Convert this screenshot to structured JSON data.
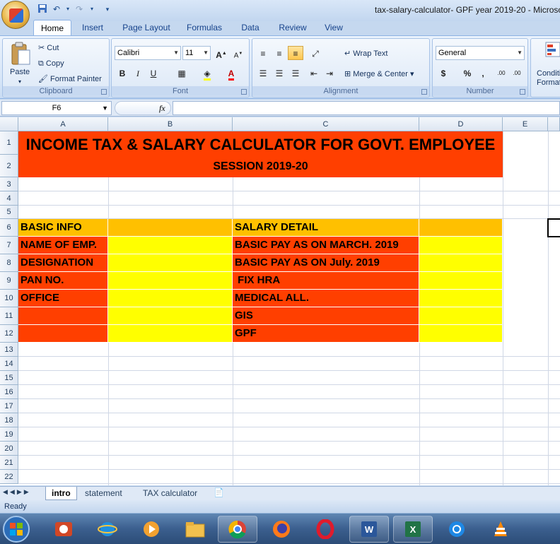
{
  "window": {
    "title": "tax-salary-calculator- GPF year 2019-20 - Microso"
  },
  "quick_access": {
    "save_icon": "save-icon",
    "undo_icon": "undo-icon",
    "redo_icon": "redo-icon"
  },
  "ribbon": {
    "tabs": [
      "Home",
      "Insert",
      "Page Layout",
      "Formulas",
      "Data",
      "Review",
      "View"
    ],
    "active_tab": "Home",
    "clipboard": {
      "paste": "Paste",
      "cut": "Cut",
      "copy": "Copy",
      "format_painter": "Format Painter",
      "label": "Clipboard"
    },
    "font": {
      "name": "Calibri",
      "size": "11",
      "bold": "B",
      "italic": "I",
      "underline": "U",
      "grow": "A",
      "shrink": "A",
      "font_color": "A",
      "label": "Font"
    },
    "alignment": {
      "wrap_text": "Wrap Text",
      "merge_center": "Merge & Center",
      "label": "Alignment"
    },
    "number": {
      "format": "General",
      "currency": "$",
      "percent": "%",
      "comma": ",",
      "inc_decimal": ".00",
      "dec_decimal": ".00",
      "label": "Number"
    },
    "styles": {
      "conditional": "Conditi",
      "conditional2": "Format"
    }
  },
  "formula_bar": {
    "name_box": "F6",
    "fx": "fx",
    "value": ""
  },
  "columns": [
    "A",
    "B",
    "C",
    "D",
    "E"
  ],
  "rows": [
    "1",
    "2",
    "3",
    "4",
    "5",
    "6",
    "7",
    "8",
    "9",
    "10",
    "11",
    "12",
    "13",
    "14",
    "15",
    "16",
    "17",
    "18",
    "19",
    "20",
    "21",
    "22"
  ],
  "cells": {
    "A1": "INCOME TAX & SALARY CALCULATOR FOR GOVT. EMPLOYEE",
    "A2": "SESSION 2019-20",
    "A6": "BASIC INFO",
    "C6": "SALARY DETAIL",
    "A7": "NAME OF EMP.",
    "C7": "BASIC PAY AS ON MARCH. 2019",
    "A8": "DESIGNATION",
    "C8": "BASIC PAY AS ON July. 2019",
    "A9": "PAN NO.",
    "C9": " FIX HRA",
    "A10": "OFFICE",
    "C10": "MEDICAL ALL.",
    "C11": "GIS",
    "C12": "GPF"
  },
  "colors": {
    "header_red": "#ff3f00",
    "label_orange": "#ffc000",
    "input_yellow": "#ffff00",
    "section_orange": "#ff3f00"
  },
  "sheets": [
    "intro",
    "statement",
    "TAX calculator"
  ],
  "active_sheet": "intro",
  "status": "Ready",
  "taskbar": {
    "items": [
      "start-orb-icon",
      "powerpoint-viewer-icon",
      "internet-explorer-icon",
      "media-player-icon",
      "file-explorer-icon",
      "chrome-icon",
      "firefox-icon",
      "opera-icon",
      "word-icon",
      "excel-icon",
      "sync-app-icon",
      "vlc-icon"
    ]
  }
}
